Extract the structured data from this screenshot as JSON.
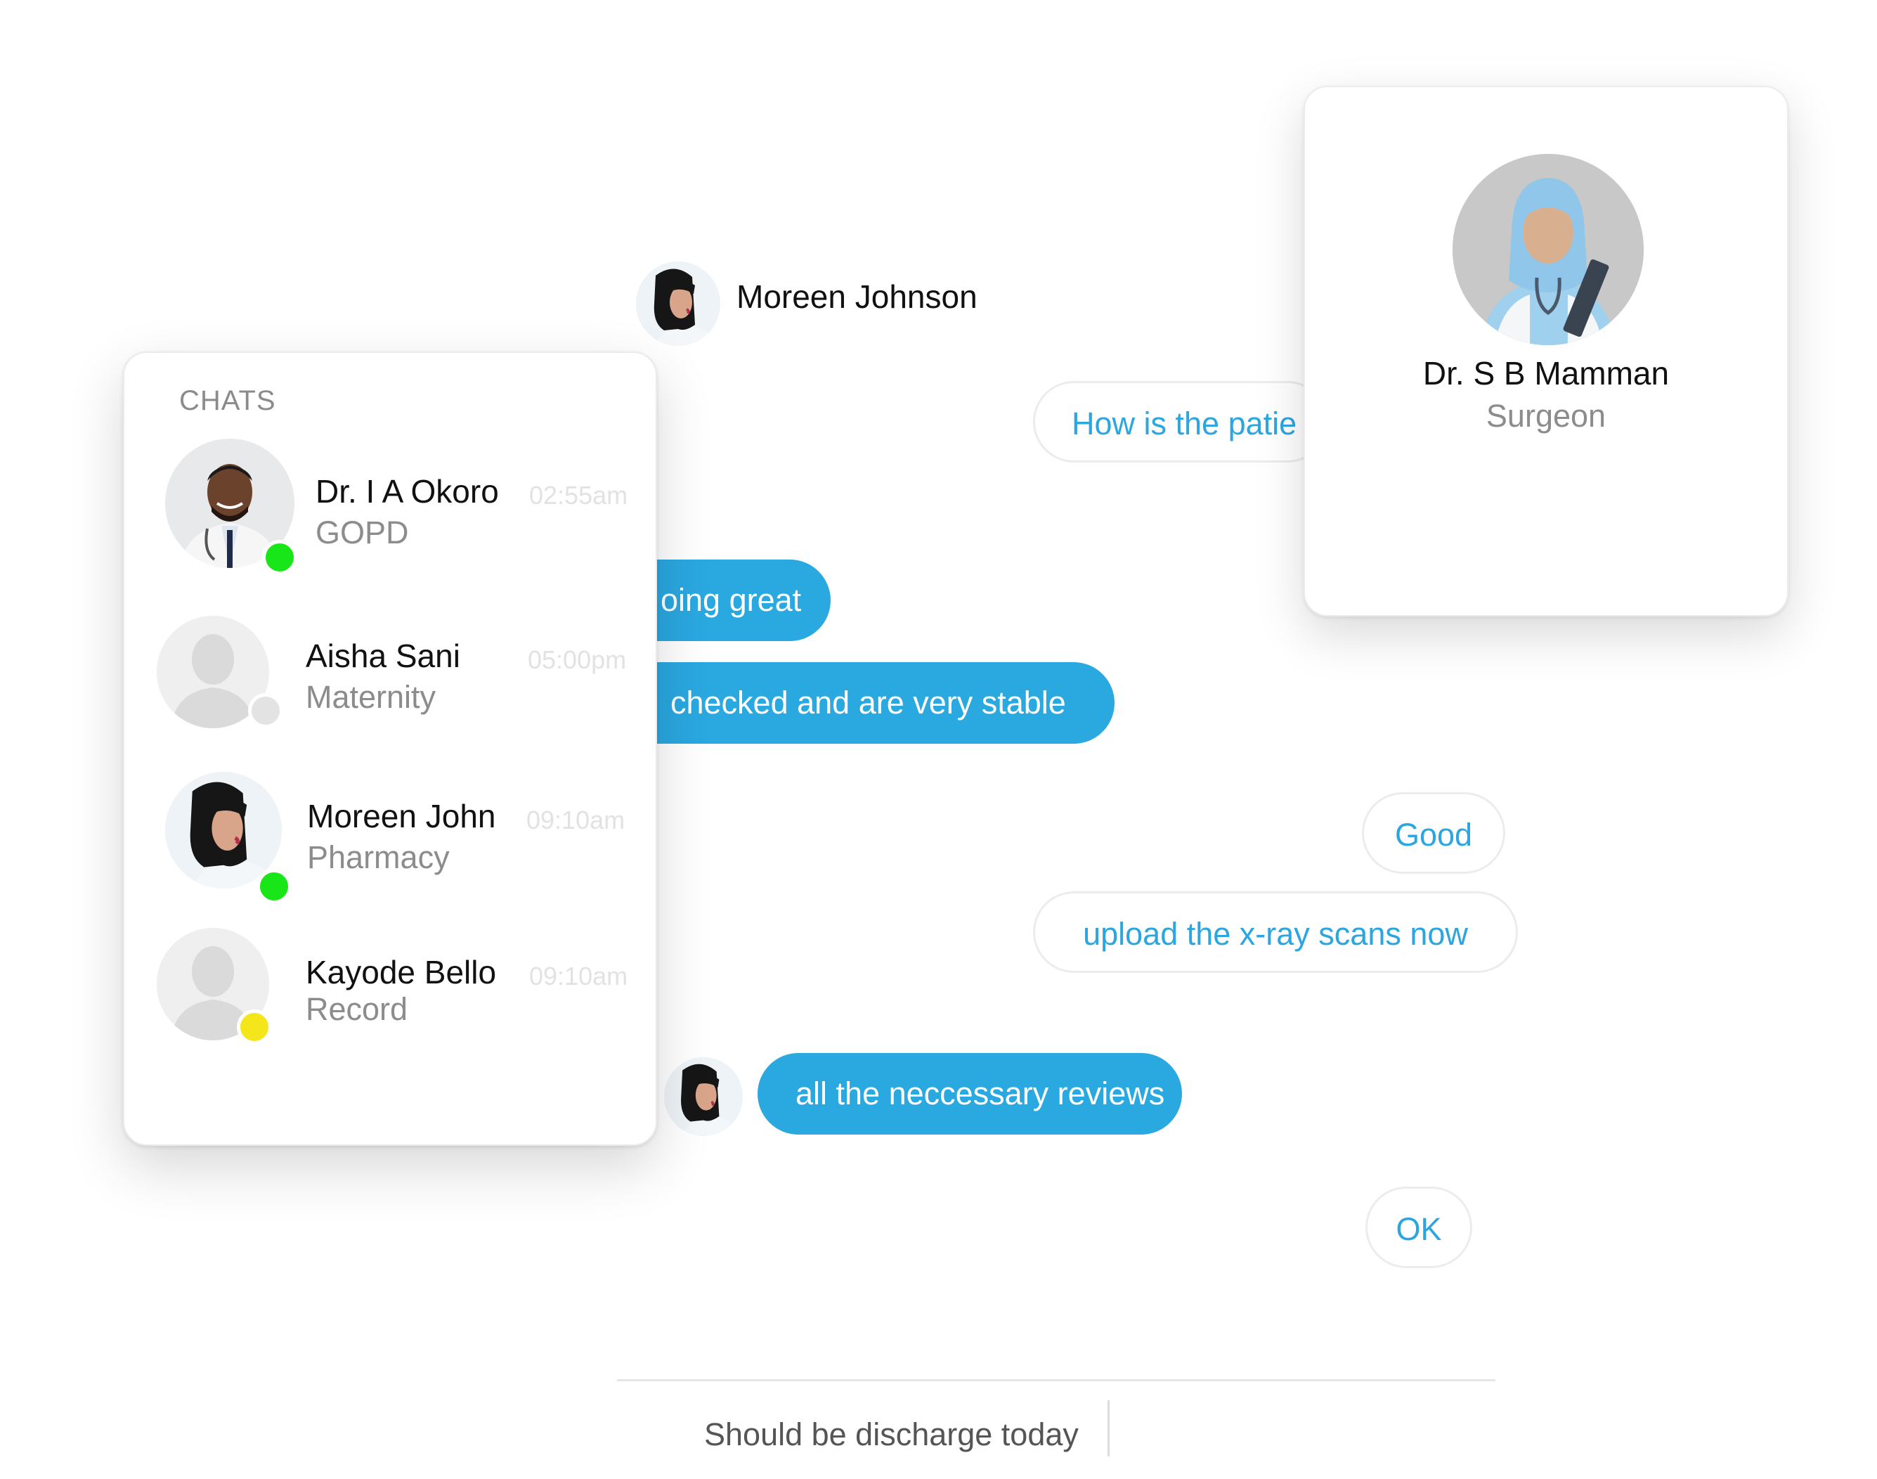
{
  "conversation": {
    "contact_name": "Moreen Johnson",
    "messages": [
      {
        "side": "out",
        "text": "How is the patie"
      },
      {
        "side": "in",
        "text": "oing great"
      },
      {
        "side": "in",
        "text": "checked and are very stable"
      },
      {
        "side": "out",
        "text": "Good"
      },
      {
        "side": "out",
        "text": "upload the x-ray scans now"
      },
      {
        "side": "in",
        "text": "all the neccessary reviews"
      },
      {
        "side": "out",
        "text": "OK"
      }
    ]
  },
  "chats_panel": {
    "heading": "CHATS",
    "items": [
      {
        "name": "Dr. I A Okoro",
        "department": "GOPD",
        "time": "02:55am",
        "status_color": "#19e619",
        "avatar": "doctor-male-photo"
      },
      {
        "name": "Aisha Sani",
        "department": "Maternity",
        "time": "05:00pm",
        "status_color": "#e3e3e3",
        "avatar": "placeholder-silhouette"
      },
      {
        "name": "Moreen John",
        "department": "Pharmacy",
        "time": "09:10am",
        "status_color": "#19e619",
        "avatar": "pharmacist-female-photo"
      },
      {
        "name": "Kayode Bello",
        "department": "Record",
        "time": "09:10am",
        "status_color": "#f5e51b",
        "avatar": "placeholder-silhouette"
      }
    ]
  },
  "profile_card": {
    "name": "Dr. S B Mamman",
    "role": "Surgeon",
    "avatar": "surgeon-hijab-photo"
  },
  "composer": {
    "value": "Should be discharge today"
  },
  "colors": {
    "accent": "#2aa8e0",
    "online": "#19e619",
    "away": "#f5e51b",
    "offline": "#e3e3e3"
  }
}
